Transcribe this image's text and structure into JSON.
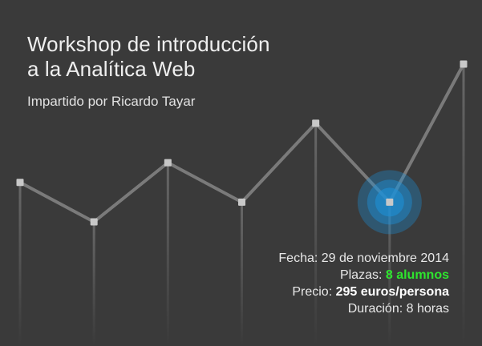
{
  "title_line1": "Workshop de introducción",
  "title_line2": "a la Analítica Web",
  "subtitle": "Impartido por Ricardo Tayar",
  "details": {
    "fecha_label": "Fecha:",
    "fecha_value": "29 de noviembre 2014",
    "plazas_label": "Plazas:",
    "plazas_value": "8 alumnos",
    "precio_label": "Precio:",
    "precio_value": "295 euros/persona",
    "duracion_label": "Duración:",
    "duracion_value": "8 horas"
  },
  "colors": {
    "background": "#3a3a3a",
    "line": "#7a7a7a",
    "highlight": "#1e90d6",
    "accent_green": "#2ee52e"
  },
  "chart_data": {
    "type": "line",
    "x": [
      1,
      2,
      3,
      4,
      5,
      6,
      7
    ],
    "values": [
      4,
      2,
      5,
      3,
      7,
      3,
      10
    ],
    "highlight_index": 5
  }
}
